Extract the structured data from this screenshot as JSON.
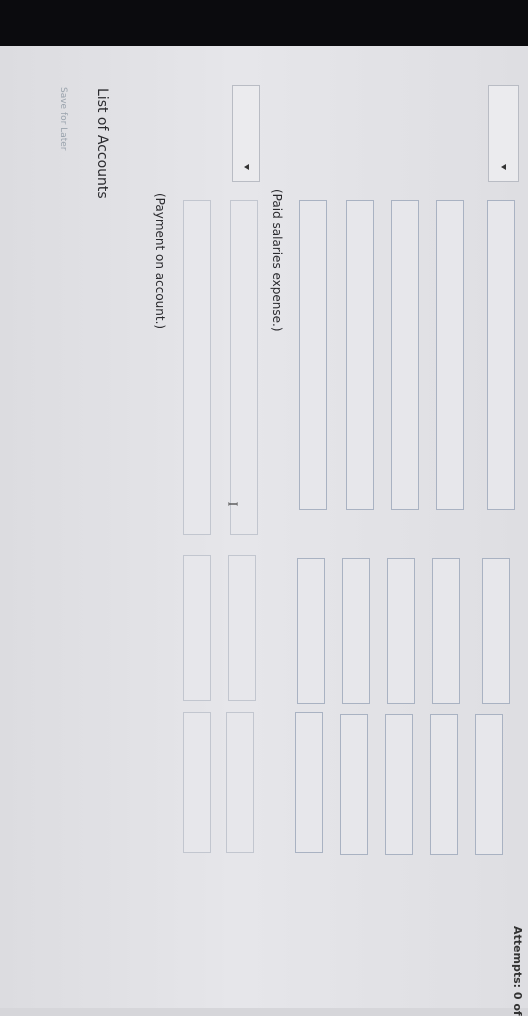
{
  "list_of_accounts_label": "List of Accounts",
  "save_for_later_label": "Save for Later",
  "attempts_label": "Attempts: 0 of",
  "entries": [
    {
      "note": "(Paid salaries expense.)"
    },
    {
      "note": "(Payment on account.)"
    }
  ],
  "icons": {
    "dropdown": "chevron-down-icon",
    "cursor": "text-cursor-icon"
  }
}
